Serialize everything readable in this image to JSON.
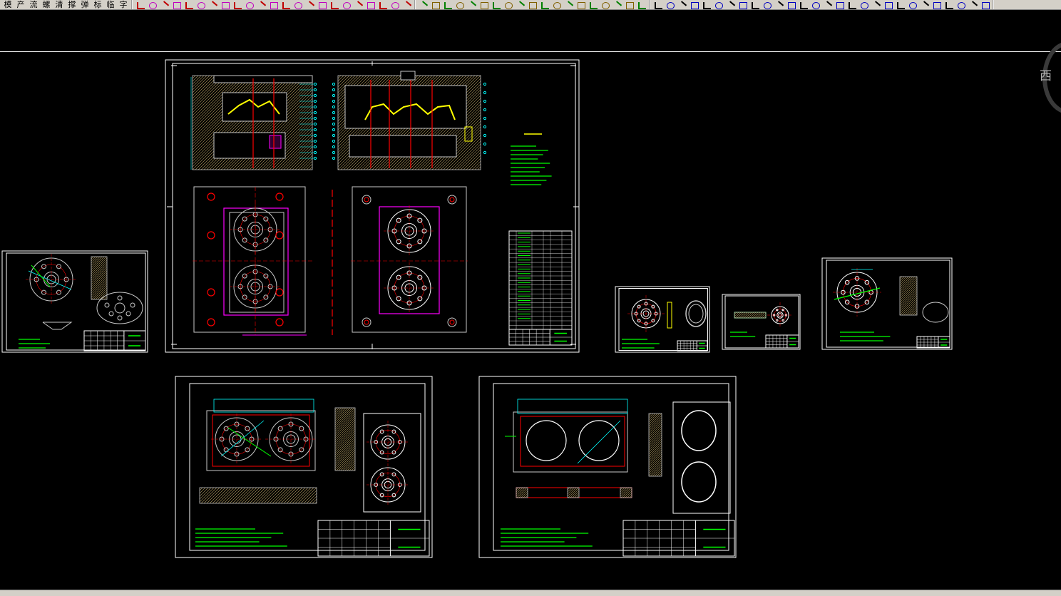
{
  "toolbar": {
    "cad_menu_labels": [
      "模",
      "产",
      "流",
      "螺",
      "清",
      "撑",
      "弹",
      "标",
      "临",
      "字"
    ],
    "button_count_group2": 23,
    "button_count_group3": 19,
    "button_count_group4": 28
  },
  "viewcube": {
    "direction_label": "西"
  },
  "colors": {
    "background": "#000000",
    "frame": "#ffffff",
    "geometry": "#c8c8c8",
    "annotation": "#00ff00",
    "centerline": "#ff0000",
    "dimension": "#00ffff",
    "highlight": "#ff00ff",
    "part_yellow": "#ffff00",
    "hatch": "#b8a060"
  },
  "sheets": [
    {
      "name": "assembly-drawing"
    },
    {
      "name": "part-flange-small"
    },
    {
      "name": "part-ring"
    },
    {
      "name": "part-strip"
    },
    {
      "name": "part-flange-large"
    },
    {
      "name": "cavity-plate"
    },
    {
      "name": "core-plate"
    }
  ]
}
